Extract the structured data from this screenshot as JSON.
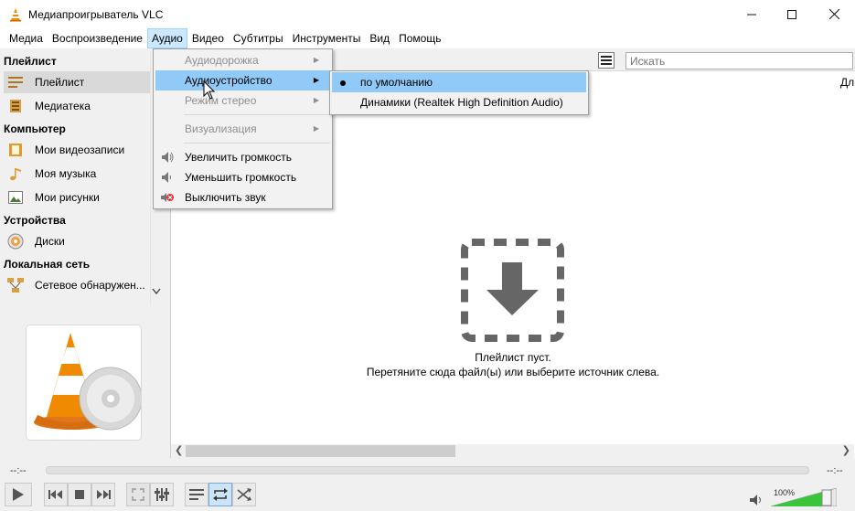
{
  "window": {
    "title": "Медиапроигрыватель VLC",
    "minimize": "—",
    "maximize": "☐",
    "close": "✕"
  },
  "menubar": [
    "Медиа",
    "Воспроизведение",
    "Аудио",
    "Видео",
    "Субтитры",
    "Инструменты",
    "Вид",
    "Помощь"
  ],
  "sidebar": {
    "sections": {
      "playlist": "Плейлист",
      "computer": "Компьютер",
      "devices": "Устройства",
      "network": "Локальная сеть"
    },
    "items": {
      "playlist": "Плейлист",
      "library": "Медиатека",
      "videos": "Мои видеозаписи",
      "music": "Моя музыка",
      "pictures": "Мои рисунки",
      "discs": "Диски",
      "network_discovery": "Сетевое обнаружен..."
    }
  },
  "search": {
    "placeholder": "Искать"
  },
  "column_header": "Дл",
  "playlist_empty": {
    "line1": "Плейлист пуст.",
    "line2": "Перетяните сюда файл(ы) или выберите источник слева."
  },
  "player": {
    "time_elapsed": "--:--",
    "time_total": "--:--",
    "volume": "100%"
  },
  "audio_menu": {
    "track": "Аудиодорожка",
    "device": "Аудиоустройство",
    "stereo": "Режим стерео",
    "visualization": "Визуализация",
    "vol_up": "Увеличить громкость",
    "vol_down": "Уменьшить громкость",
    "mute": "Выключить звук"
  },
  "device_submenu": {
    "default": "по умолчанию",
    "speakers": "Динамики (Realtek High Definition Audio)",
    "selected": "по умолчанию"
  },
  "colors": {
    "menu_highlight": "#91c9f7",
    "accent_orange": "#f08a00",
    "volume_green": "#3bc43b"
  }
}
